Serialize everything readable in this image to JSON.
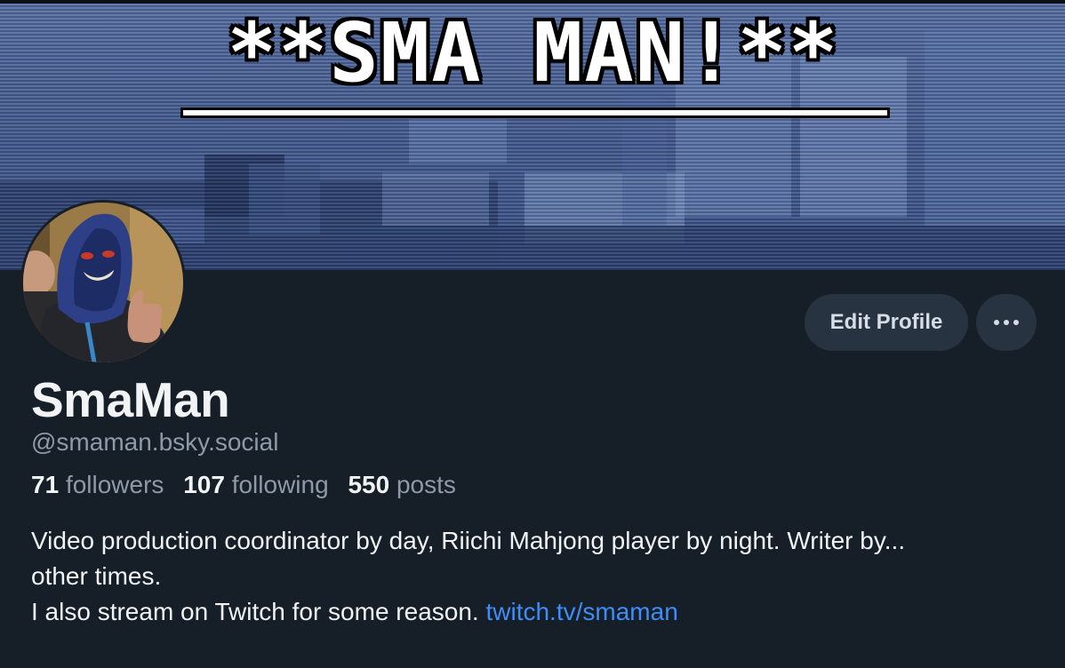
{
  "banner": {
    "title": "**SMA MAN!**"
  },
  "profile": {
    "display_name": "SmaMan",
    "handle": "@smaman.bsky.social",
    "stats": {
      "followers_count": "71",
      "followers_label": "followers",
      "following_count": "107",
      "following_label": "following",
      "posts_count": "550",
      "posts_label": "posts"
    },
    "bio": {
      "line1": "Video production coordinator by day, Riichi Mahjong player by night. Writer by...",
      "line2": "other times.",
      "line3": "I also stream on Twitch for some reason. ",
      "link": "twitch.tv/smaman"
    }
  },
  "actions": {
    "edit_profile_label": "Edit Profile",
    "more_icon": "ellipsis-horizontal-icon"
  },
  "colors": {
    "background": "#161e27",
    "button_bg": "#283341",
    "muted_text": "#8f9aa8",
    "link": "#3d8ef7",
    "banner_blue": "#3f5688"
  }
}
